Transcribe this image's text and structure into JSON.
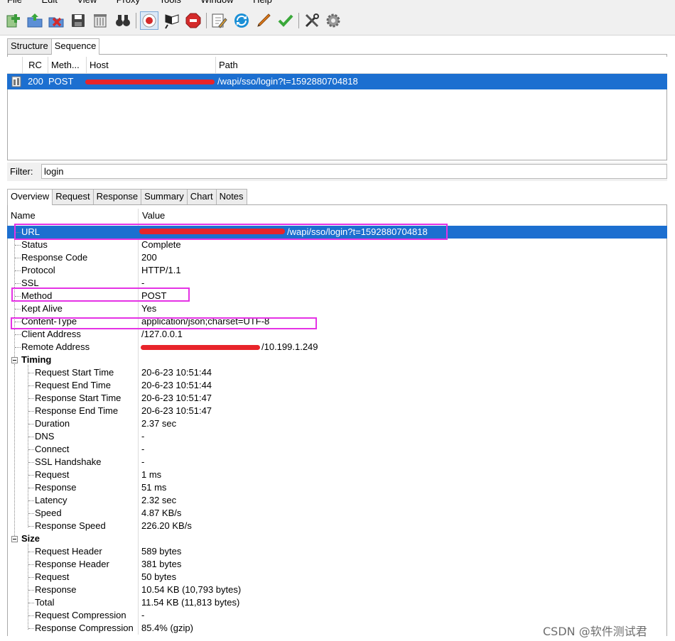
{
  "menu": [
    "File",
    "Edit",
    "View",
    "Proxy",
    "Tools",
    "Window",
    "Help"
  ],
  "toolbar": {
    "buttons": [
      {
        "name": "new-session-icon",
        "color": "#3a9a3a"
      },
      {
        "name": "open-session-icon",
        "color": "#3a78c8"
      },
      {
        "name": "close-session-icon",
        "color": "#d42b2b"
      },
      {
        "name": "save-icon",
        "color": "#444444"
      },
      {
        "name": "clear-session-icon",
        "color": "#555555"
      },
      {
        "name": "find-icon",
        "color": "#222222"
      },
      {
        "name": "record-icon",
        "color": "#d42b2b"
      },
      {
        "name": "throttle-icon",
        "color": "#222222"
      },
      {
        "name": "breakpoints-icon",
        "color": "#d42b2b"
      },
      {
        "name": "edit-icon",
        "color": "#3a78c8"
      },
      {
        "name": "repeat-icon",
        "color": "#1a8fd6"
      },
      {
        "name": "validate-icon",
        "color": "#e07b1a"
      },
      {
        "name": "check-icon",
        "color": "#3aa83a"
      },
      {
        "name": "tools-icon",
        "color": "#333333"
      },
      {
        "name": "settings-icon",
        "color": "#888888"
      }
    ]
  },
  "top_tabs": [
    "Structure",
    "Sequence"
  ],
  "sequence_table": {
    "headers": [
      "RC",
      "Meth...",
      "Host",
      "Path"
    ],
    "rows": [
      {
        "rc": "200",
        "method": "POST",
        "host": "",
        "path": "/wapi/sso/login?t=1592880704818"
      }
    ]
  },
  "filter": {
    "label": "Filter:",
    "value": "login"
  },
  "detail_tabs": [
    "Overview",
    "Request",
    "Response",
    "Summary",
    "Chart",
    "Notes"
  ],
  "overview": {
    "columns": {
      "name": "Name",
      "value": "Value"
    },
    "rows": [
      {
        "name": "URL",
        "value": "/wapi/sso/login?t=1592880704818"
      },
      {
        "name": "Status",
        "value": "Complete"
      },
      {
        "name": "Response Code",
        "value": "200"
      },
      {
        "name": "Protocol",
        "value": "HTTP/1.1"
      },
      {
        "name": "SSL",
        "value": "-"
      },
      {
        "name": "Method",
        "value": "POST"
      },
      {
        "name": "Kept Alive",
        "value": "Yes"
      },
      {
        "name": "Content-Type",
        "value": "application/json;charset=UTF-8"
      },
      {
        "name": "Client Address",
        "value": "/127.0.0.1"
      },
      {
        "name": "Remote Address",
        "value": "/10.199.1.249"
      }
    ],
    "timing": {
      "title": "Timing",
      "rows": [
        {
          "name": "Request Start Time",
          "value": "20-6-23 10:51:44"
        },
        {
          "name": "Request End Time",
          "value": "20-6-23 10:51:44"
        },
        {
          "name": "Response Start Time",
          "value": "20-6-23 10:51:47"
        },
        {
          "name": "Response End Time",
          "value": "20-6-23 10:51:47"
        },
        {
          "name": "Duration",
          "value": "2.37 sec"
        },
        {
          "name": "DNS",
          "value": "-"
        },
        {
          "name": "Connect",
          "value": "-"
        },
        {
          "name": "SSL Handshake",
          "value": "-"
        },
        {
          "name": "Request",
          "value": "1 ms"
        },
        {
          "name": "Response",
          "value": "51 ms"
        },
        {
          "name": "Latency",
          "value": "2.32 sec"
        },
        {
          "name": "Speed",
          "value": "4.87 KB/s"
        },
        {
          "name": "Response Speed",
          "value": "226.20 KB/s"
        }
      ]
    },
    "size": {
      "title": "Size",
      "rows": [
        {
          "name": "Request Header",
          "value": "589 bytes"
        },
        {
          "name": "Response Header",
          "value": "381 bytes"
        },
        {
          "name": "Request",
          "value": "50 bytes"
        },
        {
          "name": "Response",
          "value": "10.54 KB (10,793 bytes)"
        },
        {
          "name": "Total",
          "value": "11.54 KB (11,813 bytes)"
        },
        {
          "name": "Request Compression",
          "value": "-"
        },
        {
          "name": "Response Compression",
          "value": "85.4% (gzip)"
        }
      ]
    }
  },
  "watermark": "CSDN @软件测试君",
  "colors": {
    "selection": "#1c6fd0",
    "highlight_box": "#e532e5",
    "redaction": "#e8242a"
  }
}
